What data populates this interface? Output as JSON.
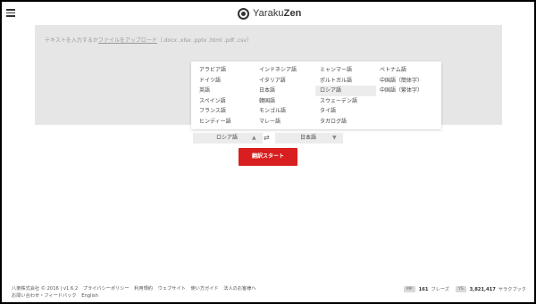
{
  "header": {
    "brand_light": "Yaraku",
    "brand_bold": "Zen"
  },
  "input": {
    "hint_prefix": "テキストを入力するか",
    "hint_link": "ファイルをアップロード",
    "hint_suffix": "（.docx .xlsx .pptx .html .pdf .csv）"
  },
  "language_menu": {
    "selected": "ロシア語",
    "columns": [
      [
        "アラビア語",
        "ドイツ語",
        "英語",
        "スペイン語",
        "フランス語",
        "ヒンディー語"
      ],
      [
        "インドネシア語",
        "イタリア語",
        "日本語",
        "韓国語",
        "モンゴル語",
        "マレー語"
      ],
      [
        "ミャンマー語",
        "ポルトガル語",
        "ロシア語",
        "スウェーデン語",
        "タイ語",
        "タガログ語"
      ],
      [
        "ベトナム語",
        "中国語（簡体字）",
        "中国語（繁体字）"
      ]
    ]
  },
  "translator": {
    "source_lang": "ロシア語",
    "target_lang": "日本語",
    "swap_symbol": "⇄",
    "caret_up": "▲",
    "caret_down": "▼",
    "start_label": "翻訳スタート"
  },
  "footer": {
    "copyright": "八楽株式会社 © 2016 | v1.6.2",
    "links": [
      "プライバシーポリシー",
      "利用規約",
      "ウェブサイト",
      "使い方ガイド",
      "法人のお客様へ"
    ],
    "contact": "お問い合わせ・フィードバック",
    "language": "English",
    "phrases_badge": "MP",
    "phrases_count": "161",
    "phrases_label": "フレーズ",
    "bookmarks_badge": "YS",
    "bookmarks_count": "3,821,417",
    "bookmarks_label": "ヤラクブック"
  }
}
